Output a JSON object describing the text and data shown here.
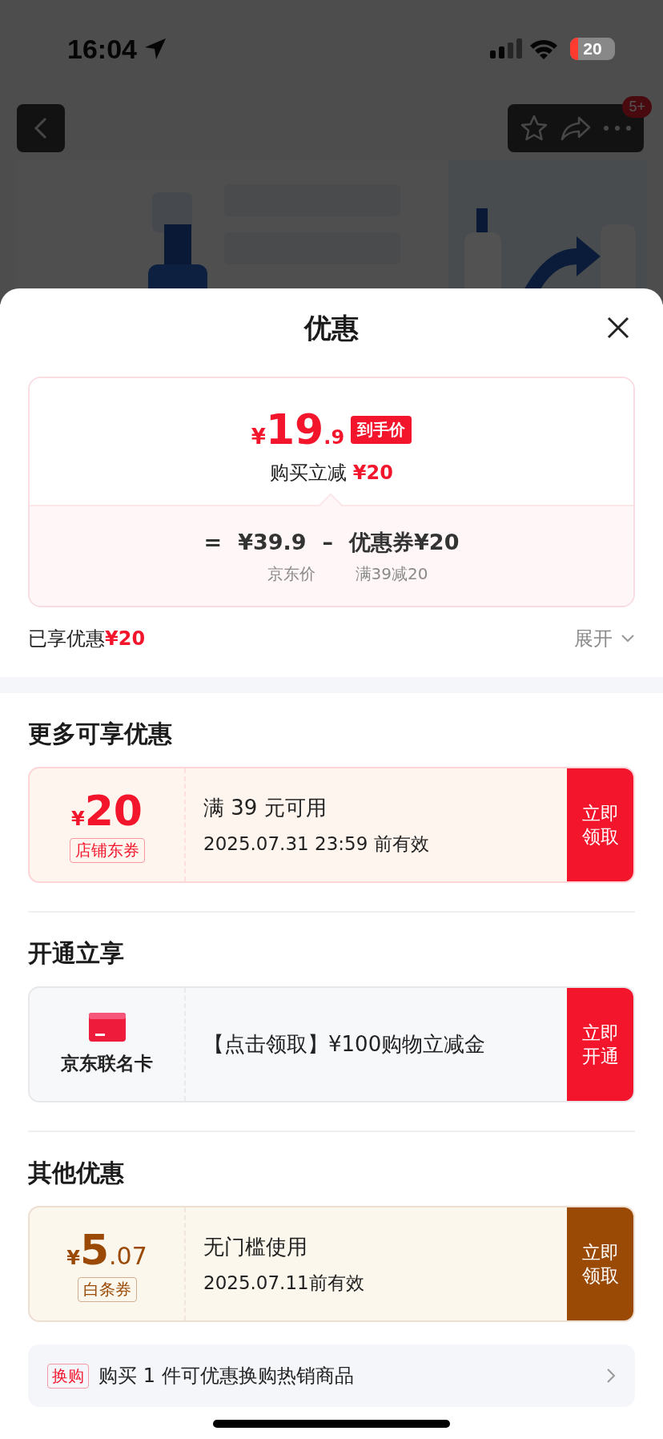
{
  "status_bar": {
    "time": "16:04",
    "battery": "20"
  },
  "nav": {
    "badge": "5+"
  },
  "sheet": {
    "title": "优惠",
    "price_card": {
      "currency": "¥",
      "price_int": "19",
      "price_dec": ".9",
      "price_tag": "到手价",
      "saving_label": "购买立减",
      "saving_amount": "¥20",
      "equals": "=",
      "base_price": "¥39.9",
      "minus": "–",
      "coupon_label": "优惠券¥20",
      "base_caption": "京东价",
      "coupon_caption": "满39减20"
    },
    "enjoyed": {
      "label": "已享优惠",
      "amount": "¥20",
      "expand": "展开"
    },
    "sections": [
      {
        "title": "更多可享优惠",
        "offers": [
          {
            "kind": "coupon",
            "color": "#f2152c",
            "currency": "¥",
            "amount": "20",
            "tag": "店铺东券",
            "condition": "满 39 元可用",
            "expiry": "2025.07.31 23:59 前有效",
            "action": "立即领取"
          }
        ]
      },
      {
        "title": "开通立享",
        "offers": [
          {
            "kind": "card",
            "color": "#f2152c",
            "name": "京东联名卡",
            "text": "【点击领取】¥100购物立减金",
            "action": "立即开通"
          }
        ]
      },
      {
        "title": "其他优惠",
        "offers": [
          {
            "kind": "coupon",
            "color": "#9a4a05",
            "currency": "¥",
            "amount": "5",
            "decimals": ".07",
            "tag": "白条券",
            "condition": "无门槛使用",
            "expiry": "2025.07.11前有效",
            "action": "立即领取"
          }
        ]
      }
    ],
    "exchange": {
      "tag": "换购",
      "text": "购买 1 件可优惠换购热销商品"
    }
  }
}
